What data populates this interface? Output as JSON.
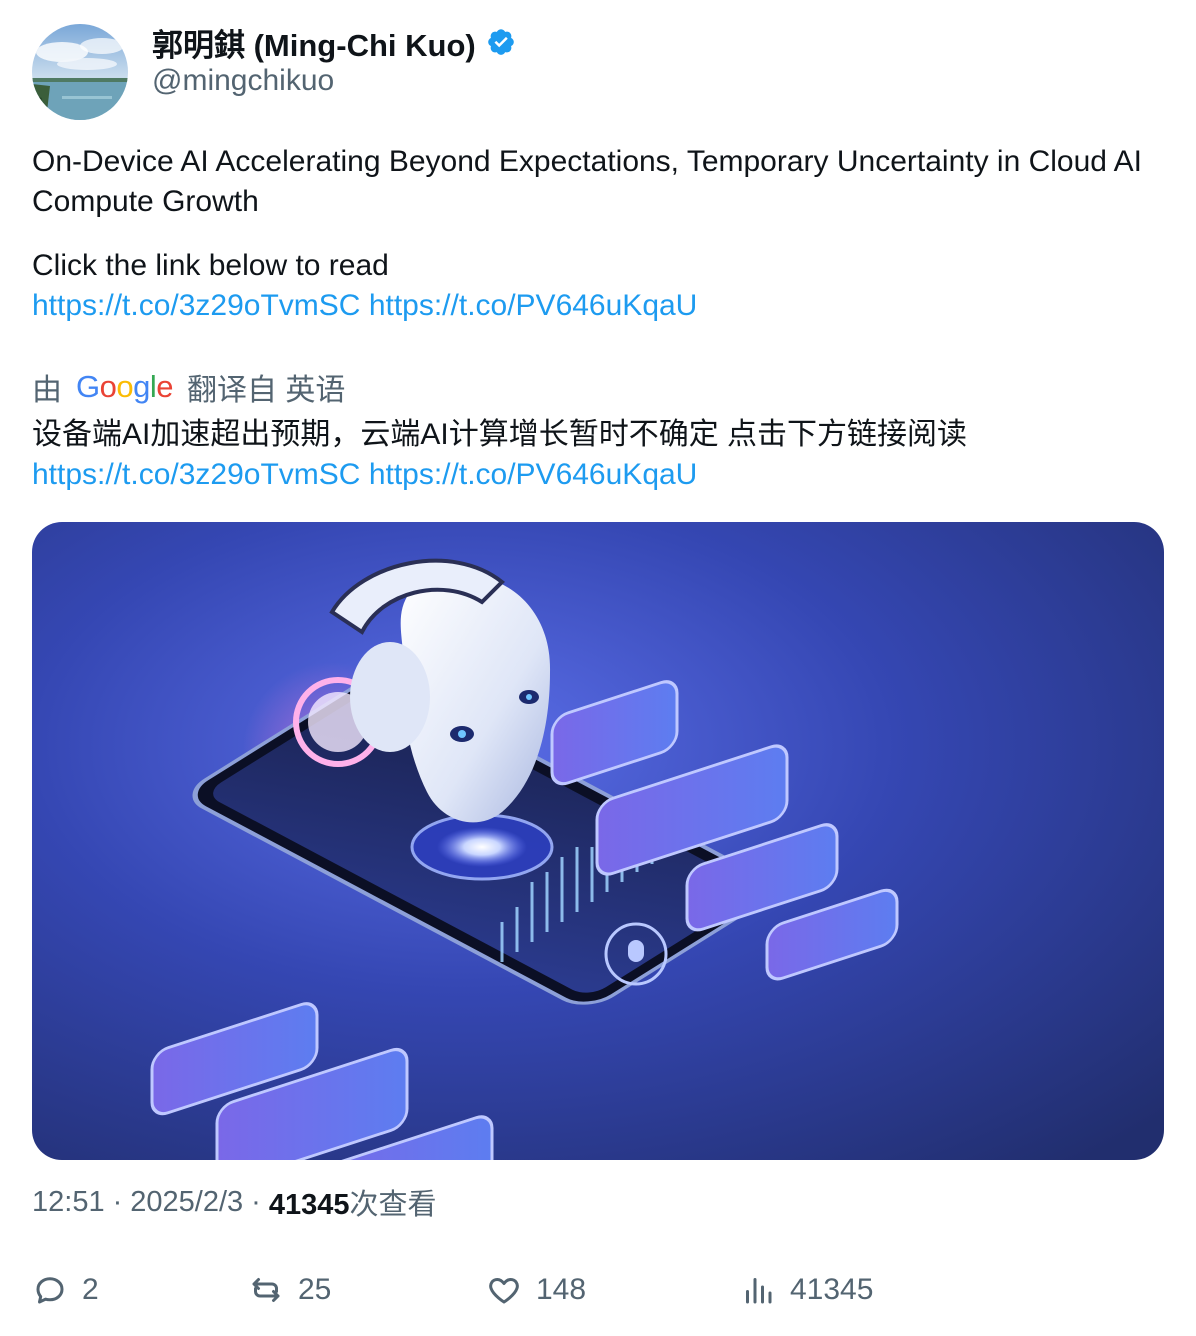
{
  "author": {
    "display_name": "郭明錤 (Ming-Chi Kuo)",
    "handle": "@mingchikuo",
    "verified": true,
    "verified_color": "#1d9bf0"
  },
  "tweet": {
    "line1": "On-Device AI Accelerating Beyond Expectations, Temporary Uncertainty in Cloud AI Compute Growth",
    "line2": "Click the link below to read",
    "link1": "https://t.co/3z29oTvmSC",
    "link2": "https://t.co/PV646uKqaU"
  },
  "translation": {
    "prefix": "由",
    "provider": "Google",
    "suffix": "翻译自 英语",
    "text": "设备端AI加速超出预期，云端AI计算增长暂时不确定 点击下方链接阅读",
    "link1": "https://t.co/3z29oTvmSC",
    "link2": "https://t.co/PV646uKqaU"
  },
  "meta": {
    "time": "12:51",
    "date": "2025/2/3",
    "views_count": "41345",
    "views_label": "次查看"
  },
  "actions": {
    "replies": "2",
    "reposts": "25",
    "likes": "148",
    "views": "41345"
  },
  "colors": {
    "link": "#1d9bf0",
    "secondary_text": "#536471",
    "primary_text": "#0f1419"
  }
}
